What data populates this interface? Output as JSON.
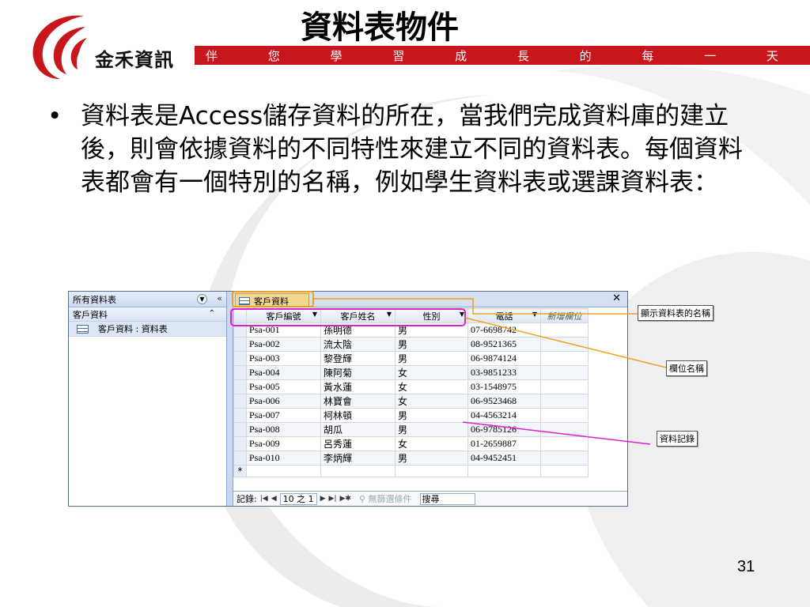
{
  "title": "資料表物件",
  "brand": {
    "name": "金禾資訊",
    "slogan": [
      "伴",
      "您",
      "學",
      "習",
      "成",
      "長",
      "的",
      "每",
      "一",
      "天"
    ],
    "colors": {
      "red": "#c8161d"
    }
  },
  "bullet": {
    "text": "資料表是Access儲存資料的所在，當我們完成資料庫的建立後，則會依據資料的不同特性來建立不同的資料表。每個資料表都會有一個特別的名稱，例如學生資料表或選課資料表："
  },
  "page_number": "31",
  "access": {
    "nav_header": "所有資料表",
    "nav_group": "客戶資料",
    "nav_item": "客戶資料 : 資料表",
    "tab_label": "客戶資料",
    "columns": [
      "客戶編號",
      "客戶姓名",
      "性別",
      "電話",
      "新增欄位"
    ],
    "rows": [
      [
        "Psa-001",
        "孫明德",
        "男",
        "07-6698742"
      ],
      [
        "Psa-002",
        "流太陰",
        "男",
        "08-9521365"
      ],
      [
        "Psa-003",
        "黎登輝",
        "男",
        "06-9874124"
      ],
      [
        "Psa-004",
        "陳阿菊",
        "女",
        "03-9851233"
      ],
      [
        "Psa-005",
        "黃水蓮",
        "女",
        "03-1548975"
      ],
      [
        "Psa-006",
        "林寶會",
        "女",
        "06-9523468"
      ],
      [
        "Psa-007",
        "柯林頓",
        "男",
        "04-4563214"
      ],
      [
        "Psa-008",
        "胡瓜",
        "男",
        "06-9785126"
      ],
      [
        "Psa-009",
        "呂秀蓮",
        "女",
        "01-2659887"
      ],
      [
        "Psa-010",
        "李炳輝",
        "男",
        "04-9452451"
      ]
    ],
    "new_row_marker": "*",
    "record_bar": {
      "label": "記錄:",
      "position": "10 之 1",
      "no_filter": "無篩選條件",
      "search": "搜尋"
    }
  },
  "callouts": {
    "table_name": "顯示資料表的名稱",
    "field_name": "欄位名稱",
    "record": "資料記錄"
  }
}
